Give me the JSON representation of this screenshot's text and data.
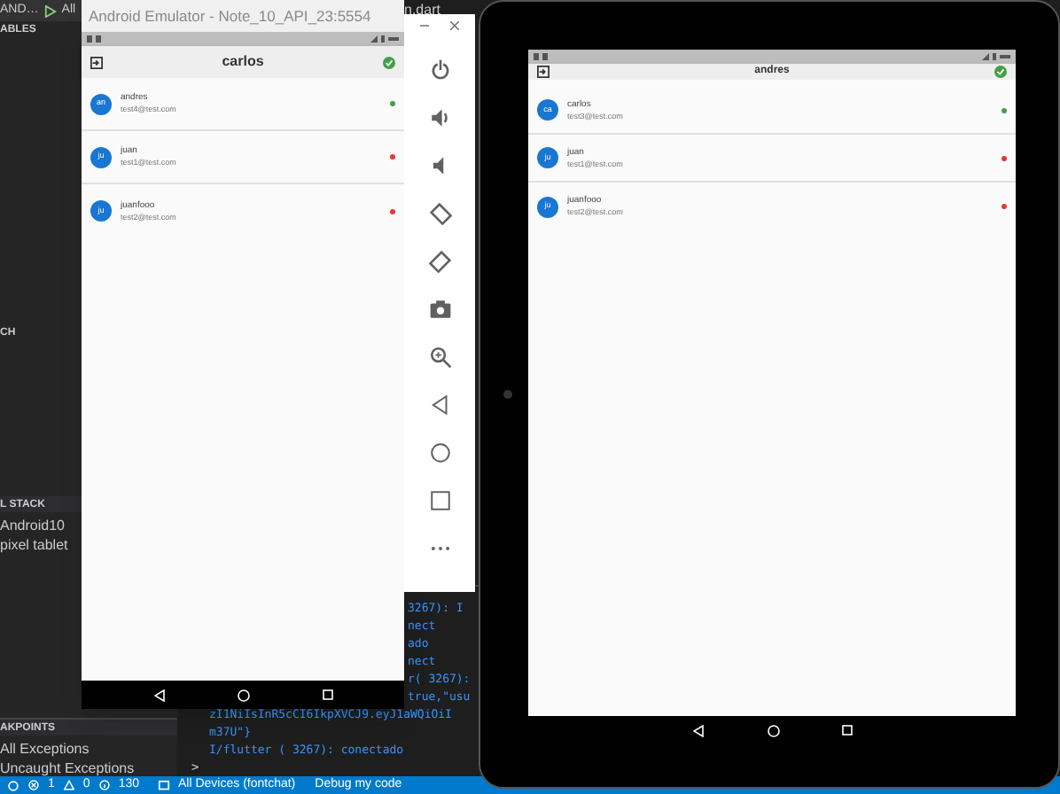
{
  "ide": {
    "toolbar": {
      "configuration": "AND…",
      "target": "All"
    },
    "editor_tab": "n.dart",
    "sidebar": {
      "variables_header": "ABLES",
      "watch_header": "CH",
      "call_stack": {
        "header": "L STACK",
        "items": [
          "Android10",
          "pixel tablet"
        ]
      },
      "breakpoints": {
        "header": "AKPOINTS",
        "items": [
          "All Exceptions",
          "Uncaught Exceptions"
        ]
      }
    },
    "terminal": {
      "clipped_lines": [
        "3267): I",
        "nect",
        "ado",
        "nect",
        "r( 3267):",
        "true,\"usu"
      ],
      "lines": [
        "zI1NiIsInR5cCI6IkpXVCJ9.eyJ1aWQiOiI",
        "m37U\"}",
        "I/flutter ( 3267): conectado",
        ">"
      ]
    },
    "status_bar": {
      "errors": "1",
      "warnings": "0",
      "infos": "130",
      "devices": "All Devices (fontchat)",
      "debug": "Debug my code"
    }
  },
  "phone_window": {
    "title": "Android Emulator - Note_10_API_23:5554",
    "app": {
      "title": "carlos",
      "connected": true,
      "users": [
        {
          "initials": "an",
          "name": "andres",
          "email": "test4@test.com",
          "online": true
        },
        {
          "initials": "ju",
          "name": "juan",
          "email": "test1@test.com",
          "online": false
        },
        {
          "initials": "ju",
          "name": "juanfooo",
          "email": "test2@test.com",
          "online": false
        }
      ]
    }
  },
  "tablet": {
    "app": {
      "title": "andres",
      "connected": true,
      "users": [
        {
          "initials": "ca",
          "name": "carlos",
          "email": "test3@test.com",
          "online": true
        },
        {
          "initials": "ju",
          "name": "juan",
          "email": "test1@test.com",
          "online": false
        },
        {
          "initials": "ju",
          "name": "juanfooo",
          "email": "test2@test.com",
          "online": false
        }
      ]
    }
  }
}
